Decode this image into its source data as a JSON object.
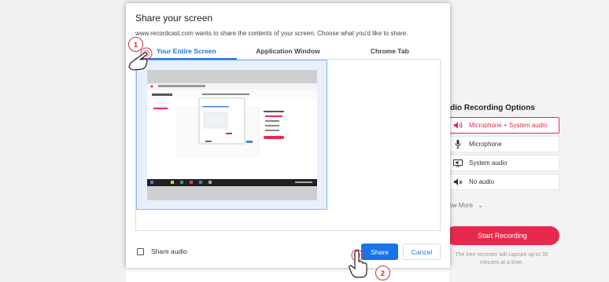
{
  "dialog": {
    "title": "Share your screen",
    "subtitle": "www.recordcast.com wants to share the contents of your screen. Choose what you'd like to share.",
    "tabs": [
      {
        "label": "Your Entire Screen",
        "active": true
      },
      {
        "label": "Application Window",
        "active": false
      },
      {
        "label": "Chrome Tab",
        "active": false
      }
    ],
    "share_audio_label": "Share audio",
    "share_label": "Share",
    "cancel_label": "Cancel"
  },
  "audio_options": {
    "title": "udio Recording Options",
    "items": [
      {
        "label": "Microphone + System audio",
        "icon": "speaker-icon",
        "active": true
      },
      {
        "label": "Microphone",
        "icon": "microphone-icon",
        "active": false
      },
      {
        "label": "System audio",
        "icon": "monitor-audio-icon",
        "active": false
      },
      {
        "label": "No audio",
        "icon": "mute-icon",
        "active": false
      }
    ],
    "show_more": "how More",
    "start_label": "Start Recording",
    "note": "The free recorder will capture up to 30 minutes at a time."
  },
  "markers": {
    "step1": "1",
    "step2": "2"
  },
  "colors": {
    "accent_blue": "#1a73e8",
    "brand_red": "#e8294e"
  }
}
